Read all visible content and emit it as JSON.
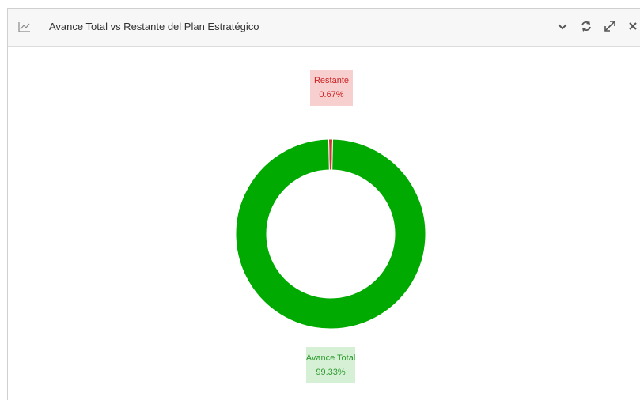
{
  "header": {
    "title": "Avance Total vs Restante del Plan Estratégico",
    "icons": [
      "line-chart-icon",
      "chevron-down-icon",
      "refresh-icon",
      "expand-icon",
      "close-icon"
    ]
  },
  "chart_data": {
    "type": "pie",
    "donut": true,
    "categories": [
      "Avance Total",
      "Restante"
    ],
    "values": [
      99.33,
      0.67
    ],
    "labels": [
      "Avance Total\n99.33%",
      "Restante\n0.67%"
    ],
    "colors": {
      "Avance Total": "#00aa00",
      "Restante": "#cc3333"
    },
    "label_backgrounds": {
      "Avance Total": "#d6f0d6",
      "Restante": "#f8cfcf"
    },
    "label_text_colors": {
      "Avance Total": "#2d9a2d",
      "Restante": "#cc2222"
    }
  }
}
